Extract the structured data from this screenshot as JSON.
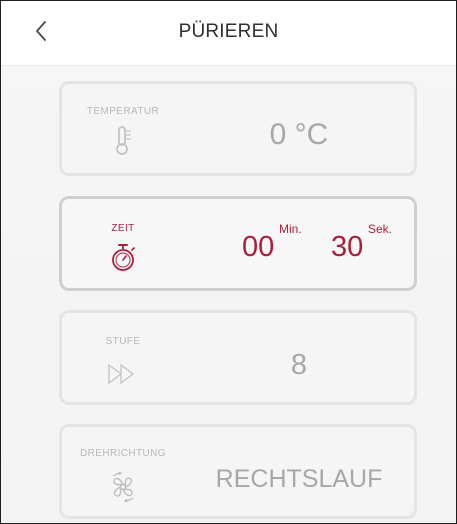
{
  "header": {
    "title": "PÜRIEREN",
    "back_icon": "chevron-left-icon"
  },
  "cards": {
    "temperature": {
      "label": "TEMPERATUR",
      "value": "0 °C",
      "icon": "thermometer-icon"
    },
    "time": {
      "label": "ZEIT",
      "minutes": "00",
      "minutes_unit": "Min.",
      "seconds": "30",
      "seconds_unit": "Sek.",
      "icon": "stopwatch-icon"
    },
    "speed": {
      "label": "STUFE",
      "value": "8",
      "icon": "fast-forward-icon"
    },
    "direction": {
      "label": "DREHRICHTUNG",
      "value": "RECHTSLAUF",
      "icon": "rotation-fan-icon"
    }
  },
  "colors": {
    "accent": "#ab1f3e",
    "muted_text": "#a7a7a7",
    "label_text": "#b7b7b7",
    "card_border": "#e4e4e4",
    "background": "#f4f4f4"
  }
}
